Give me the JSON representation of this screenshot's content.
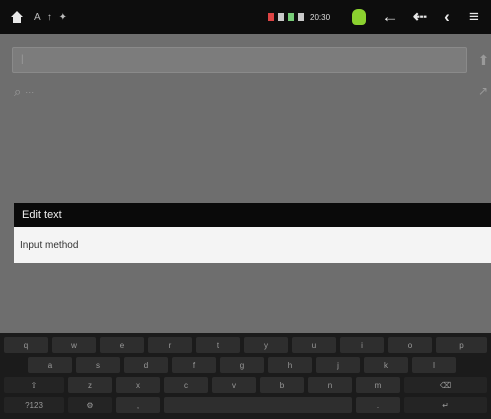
{
  "status_bar": {
    "notifications": "A ↑ ✦",
    "time": "20:30"
  },
  "search": {
    "field_text": "| ",
    "hint": "",
    "result_text": "···"
  },
  "dialog": {
    "title": "Edit text",
    "option": "Input method"
  },
  "keyboard": {
    "rows": [
      [
        "q",
        "w",
        "e",
        "r",
        "t",
        "y",
        "u",
        "i",
        "o",
        "p"
      ],
      [
        "a",
        "s",
        "d",
        "f",
        "g",
        "h",
        "j",
        "k",
        "l"
      ],
      [
        "⇧",
        "z",
        "x",
        "c",
        "v",
        "b",
        "n",
        "m",
        "⌫"
      ],
      [
        "?123",
        "⚙",
        ",",
        "",
        "",
        "",
        ".",
        "↵"
      ]
    ]
  }
}
